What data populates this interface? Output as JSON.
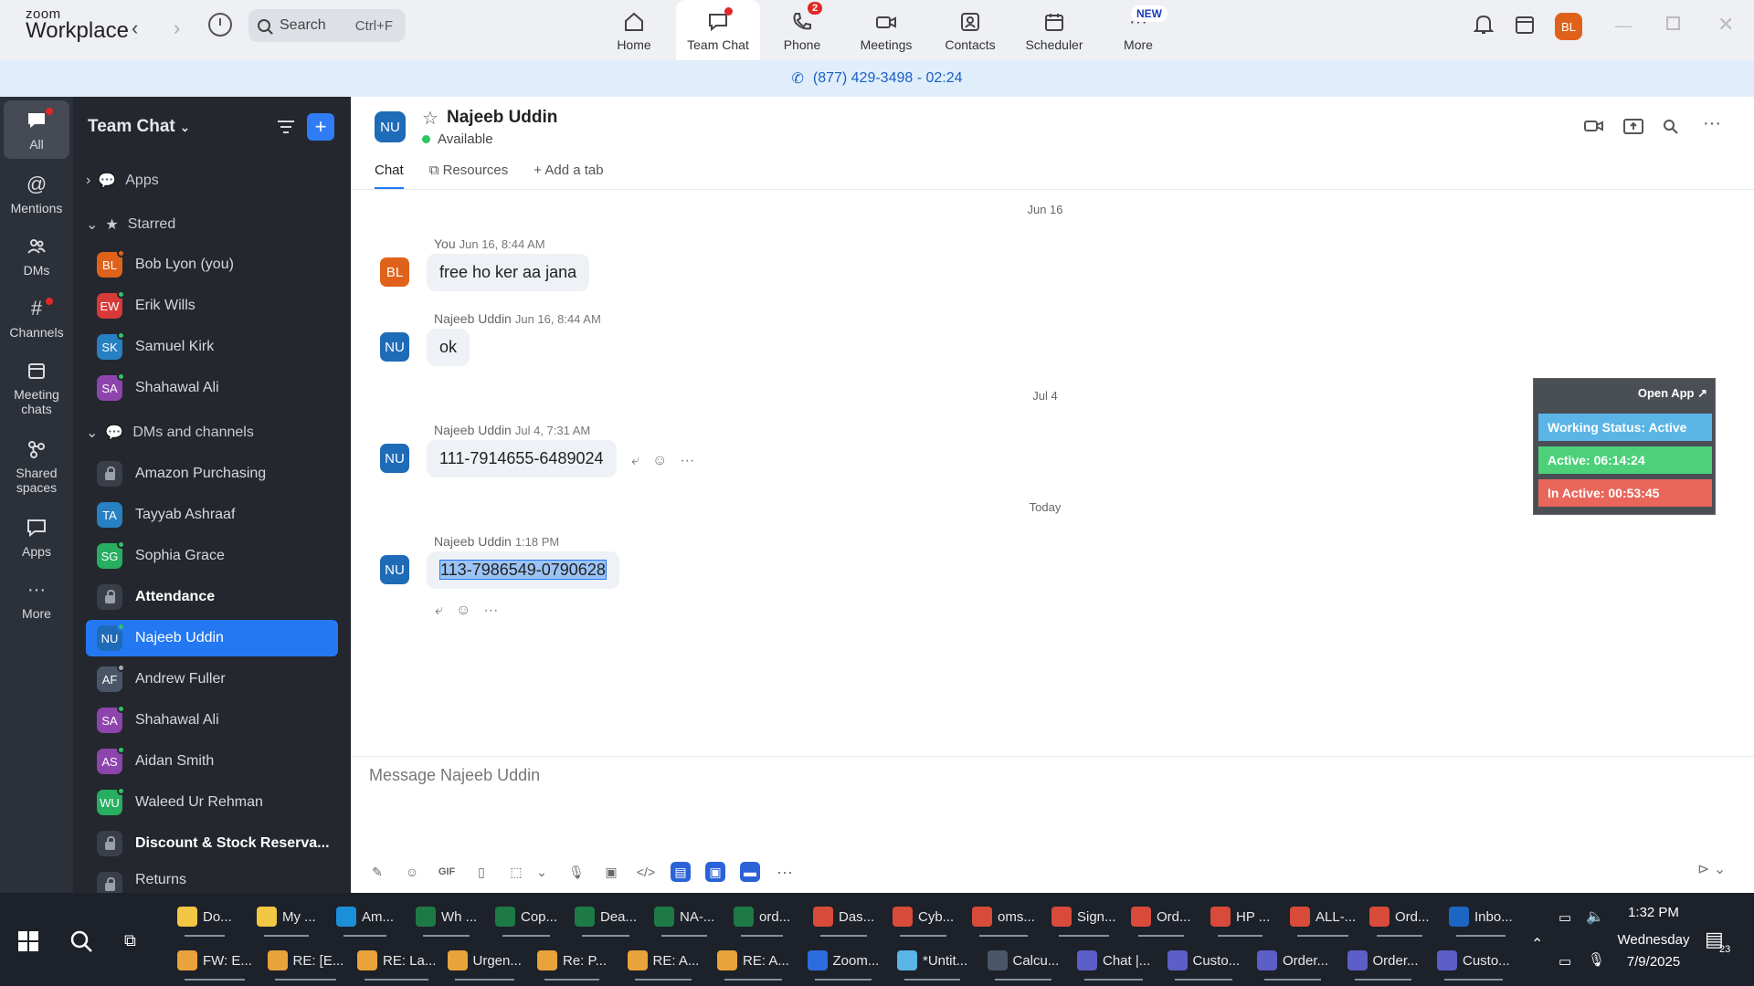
{
  "app": {
    "logo_top": "zoom",
    "logo_bottom": "Workplace",
    "search_label": "Search",
    "search_shortcut": "Ctrl+F",
    "accent": "#2478f2"
  },
  "nav_tabs": [
    {
      "label": "Home",
      "icon": "home-icon"
    },
    {
      "label": "Team Chat",
      "icon": "chat-icon",
      "active": true
    },
    {
      "label": "Phone",
      "icon": "phone-icon",
      "badge": "2"
    },
    {
      "label": "Meetings",
      "icon": "video-icon"
    },
    {
      "label": "Contacts",
      "icon": "contacts-icon"
    },
    {
      "label": "Scheduler",
      "icon": "calendar-icon"
    },
    {
      "label": "More",
      "icon": "more-icon",
      "badge": "NEW"
    }
  ],
  "top_avatar": "BL",
  "call_bar": "(877) 429-3498 - 02:24",
  "rail": [
    {
      "label": "All",
      "icon": "chat-bubble-icon",
      "active": true
    },
    {
      "label": "Mentions",
      "icon": "at-icon"
    },
    {
      "label": "DMs",
      "icon": "people-icon"
    },
    {
      "label": "Channels",
      "icon": "hash-icon"
    },
    {
      "label": "Meeting chats",
      "icon": "calendar-icon"
    },
    {
      "label": "Shared spaces",
      "icon": "shared-spaces-icon"
    },
    {
      "label": "Apps",
      "icon": "apps-icon"
    },
    {
      "label": "More",
      "icon": "more-icon"
    }
  ],
  "sidebar": {
    "title": "Team Chat",
    "apps_label": "Apps",
    "starred_label": "Starred",
    "dms_label": "DMs and channels",
    "starred": [
      {
        "initials": "BL",
        "name": "Bob Lyon (you)",
        "color": "#e0621a"
      },
      {
        "initials": "EW",
        "name": "Erik Wills",
        "color": "#d83a3a"
      },
      {
        "initials": "SK",
        "name": "Samuel Kirk",
        "color": "#2680c2"
      },
      {
        "initials": "SA",
        "name": "Shahawal Ali",
        "color": "#8e44ad"
      }
    ],
    "dms": [
      {
        "name": "Amazon Purchasing",
        "type": "lock"
      },
      {
        "initials": "TA",
        "name": "Tayyab Ashraaf",
        "color": "#2680c2"
      },
      {
        "initials": "SG",
        "name": "Sophia Grace",
        "color": "#27ae60"
      },
      {
        "name": "Attendance",
        "type": "lock",
        "bold": true
      },
      {
        "initials": "NU",
        "name": "Najeeb Uddin",
        "color": "#1e6bb8",
        "selected": true
      },
      {
        "initials": "AF",
        "name": "Andrew Fuller",
        "color": "#4a5568"
      },
      {
        "initials": "SA",
        "name": "Shahawal Ali",
        "color": "#8e44ad"
      },
      {
        "initials": "AS",
        "name": "Aidan Smith",
        "color": "#8e44ad"
      },
      {
        "initials": "WU",
        "name": "Waleed Ur Rehman",
        "color": "#27ae60"
      },
      {
        "name": "Discount & Stock Reserva...",
        "type": "lock",
        "bold": true
      },
      {
        "name": "Returns",
        "type": "lock"
      }
    ]
  },
  "chat": {
    "contact_initials": "NU",
    "contact_name": "Najeeb Uddin",
    "status": "Available",
    "tabs": [
      "Chat",
      "Resources",
      "Add a tab"
    ],
    "dates": [
      "Jun 16",
      "Jul 4",
      "Today"
    ],
    "messages": [
      {
        "initials": "BL",
        "sender": "You",
        "time": "Jun 16, 8:44 AM",
        "text": "free ho ker aa jana",
        "color": "#e0621a"
      },
      {
        "initials": "NU",
        "sender": "Najeeb Uddin",
        "time": "Jun 16, 8:44 AM",
        "text": "ok",
        "color": "#1e6bb8"
      },
      {
        "initials": "NU",
        "sender": "Najeeb Uddin",
        "time": "Jul 4, 7:31 AM",
        "text": "111-7914655-6489024",
        "color": "#1e6bb8"
      },
      {
        "initials": "NU",
        "sender": "Najeeb Uddin",
        "time": "1:18 PM",
        "text": "113-7986549-0790628",
        "color": "#1e6bb8"
      }
    ],
    "composer_placeholder": "Message Najeeb Uddin"
  },
  "widget": {
    "open_app": "Open App ↗",
    "working_status": "Working Status: Active",
    "active": "Active: 06:14:24",
    "inactive": "In Active: 00:53:45",
    "colors": [
      "#5ab4e6",
      "#4cd17a",
      "#e8665a"
    ]
  },
  "taskbar": {
    "row1": [
      {
        "label": "Do...",
        "color": "#f2c744"
      },
      {
        "label": "My ...",
        "color": "#f2c744"
      },
      {
        "label": "Am...",
        "color": "#1b8fd8"
      },
      {
        "label": "Wh ...",
        "color": "#1d7a45"
      },
      {
        "label": "Cop...",
        "color": "#1d7a45"
      },
      {
        "label": "Dea...",
        "color": "#1d7a45"
      },
      {
        "label": "NA-...",
        "color": "#1d7a45"
      },
      {
        "label": "ord...",
        "color": "#1d7a45"
      },
      {
        "label": "Das...",
        "color": "#d84a3a"
      },
      {
        "label": "Cyb...",
        "color": "#d84a3a"
      },
      {
        "label": "oms...",
        "color": "#d84a3a"
      },
      {
        "label": "Sign...",
        "color": "#d84a3a"
      },
      {
        "label": "Ord...",
        "color": "#d84a3a"
      },
      {
        "label": "HP ...",
        "color": "#d84a3a"
      },
      {
        "label": "ALL-...",
        "color": "#d84a3a"
      },
      {
        "label": "Ord...",
        "color": "#d84a3a"
      },
      {
        "label": "Inbo...",
        "color": "#1a66c2"
      }
    ],
    "row2": [
      {
        "label": "FW: E...",
        "color": "#e8a33a"
      },
      {
        "label": "RE: [E...",
        "color": "#e8a33a"
      },
      {
        "label": "RE: La...",
        "color": "#e8a33a"
      },
      {
        "label": "Urgen...",
        "color": "#e8a33a"
      },
      {
        "label": "Re: P...",
        "color": "#e8a33a"
      },
      {
        "label": "RE: A...",
        "color": "#e8a33a"
      },
      {
        "label": "RE: A...",
        "color": "#e8a33a"
      },
      {
        "label": "Zoom...",
        "color": "#2d6cdf"
      },
      {
        "label": "*Untit...",
        "color": "#5ab4e6"
      },
      {
        "label": "Calcu...",
        "color": "#4a5568"
      },
      {
        "label": "Chat |...",
        "color": "#5b5fc7"
      },
      {
        "label": "Custo...",
        "color": "#5b5fc7"
      },
      {
        "label": "Order...",
        "color": "#5b5fc7"
      },
      {
        "label": "Order...",
        "color": "#5b5fc7"
      },
      {
        "label": "Custo...",
        "color": "#5b5fc7"
      }
    ],
    "time": "1:32 PM",
    "day": "Wednesday",
    "date": "7/9/2025",
    "notif_count": "23"
  }
}
